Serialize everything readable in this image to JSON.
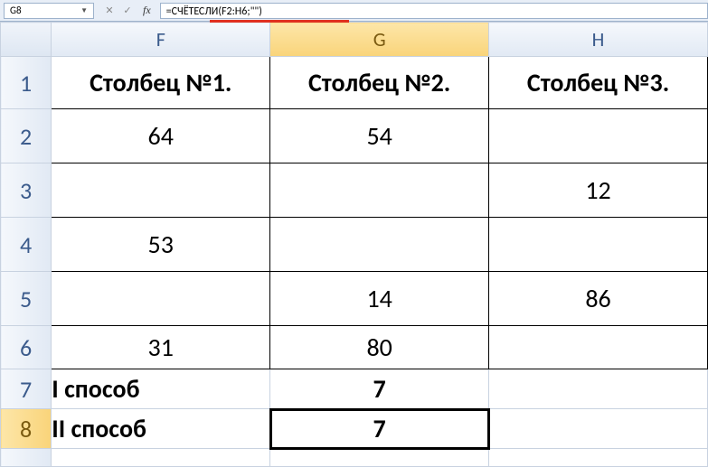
{
  "formula_bar": {
    "cell_ref": "G8",
    "fx_label": "fx",
    "formula": "=СЧЁТЕСЛИ(F2:H6;\"\")"
  },
  "columns": [
    "F",
    "G",
    "H"
  ],
  "rows": [
    "1",
    "2",
    "3",
    "4",
    "5",
    "6",
    "7",
    "8"
  ],
  "selected_column": "G",
  "selected_row": "8",
  "headers": {
    "F": "Столбец №1.",
    "G": "Столбец №2.",
    "H": "Столбец №3."
  },
  "cells": {
    "F2": "64",
    "G2": "54",
    "H2": "",
    "F3": "",
    "G3": "",
    "H3": "12",
    "F4": "53",
    "G4": "",
    "H4": "",
    "F5": "",
    "G5": "14",
    "H5": "86",
    "F6": "31",
    "G6": "80",
    "H6": "",
    "F7": "I способ",
    "G7": "7",
    "F8": "II способ",
    "G8": "7"
  },
  "chart_data": {
    "type": "table",
    "title": "",
    "columns": [
      "Столбец №1.",
      "Столбец №2.",
      "Столбец №3."
    ],
    "rows": [
      [
        64,
        54,
        null
      ],
      [
        null,
        null,
        12
      ],
      [
        53,
        null,
        null
      ],
      [
        null,
        14,
        86
      ],
      [
        31,
        80,
        null
      ]
    ],
    "summary": [
      {
        "label": "I способ",
        "value": 7
      },
      {
        "label": "II способ",
        "value": 7,
        "formula": "=СЧЁТЕСЛИ(F2:H6;\"\")"
      }
    ]
  }
}
